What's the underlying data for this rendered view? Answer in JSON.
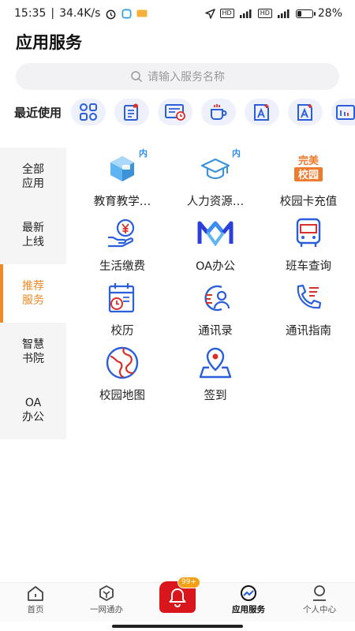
{
  "status_bar": {
    "time": "15:35",
    "speed": "34.4K/s",
    "battery": "28%",
    "net_label_1": "HD",
    "net_label_2": "4G"
  },
  "page": {
    "title": "应用服务"
  },
  "search": {
    "placeholder": "请输入服务名称"
  },
  "recent": {
    "label": "最近使用",
    "icons": [
      "apps-grid-icon",
      "notice-bell-doc-icon",
      "calendar-card-icon",
      "coffee-cup-icon",
      "font-add-icon",
      "font-add-icon",
      "bus-card-icon"
    ]
  },
  "sidebar": {
    "items": [
      {
        "label": "全部\n应用"
      },
      {
        "label": "最新\n上线"
      },
      {
        "label": "推荐\n服务"
      },
      {
        "label": "智慧\n书院"
      },
      {
        "label": "OA\n办公"
      }
    ],
    "active_index": 2
  },
  "apps": [
    {
      "label": "教育教学…",
      "icon": "cube-icon",
      "badge": "内"
    },
    {
      "label": "人力资源…",
      "icon": "graduation-cap-icon",
      "badge": "内"
    },
    {
      "label": "校园卡充值",
      "icon": "perfect-campus-logo",
      "logo_text_1": "完美",
      "logo_text_2": "校园"
    },
    {
      "label": "生活缴费",
      "icon": "yuan-hand-icon"
    },
    {
      "label": "OA办公",
      "icon": "oa-logo-icon"
    },
    {
      "label": "班车查询",
      "icon": "bus-icon"
    },
    {
      "label": "校历",
      "icon": "school-calendar-icon"
    },
    {
      "label": "通讯录",
      "icon": "contacts-icon"
    },
    {
      "label": "通讯指南",
      "icon": "phone-guide-icon"
    },
    {
      "label": "校园地图",
      "icon": "campus-map-icon"
    },
    {
      "label": "签到",
      "icon": "check-in-location-icon"
    }
  ],
  "bottom_nav": {
    "items": [
      {
        "label": "首页",
        "icon": "home-icon"
      },
      {
        "label": "一网通办",
        "icon": "box-icon"
      },
      {
        "label": "",
        "icon": "bell-icon",
        "badge": "99+"
      },
      {
        "label": "应用服务",
        "icon": "chart-circle-icon"
      },
      {
        "label": "个人中心",
        "icon": "person-icon"
      }
    ],
    "active_index": 3
  },
  "colors": {
    "accent": "#f08a24",
    "icon_blue": "#2b5fd9",
    "icon_red": "#d9302a",
    "bell_red": "#d9161b"
  }
}
